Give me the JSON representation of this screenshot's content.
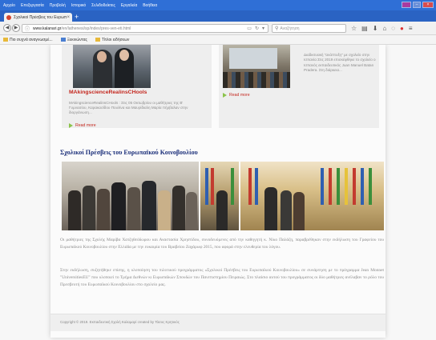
{
  "browser": {
    "menu": [
      "Αρχείο",
      "Επεξεργασία",
      "Προβολή",
      "Ιστορικό",
      "Σελιδοδείκτες",
      "Εργαλεία",
      "Βοήθεια"
    ],
    "tab_title": "Σχολικοί Πρέσβεις του Ευρωπ...",
    "url_domain": "www.kalanari.gr",
    "url_path": "/en/lathenesi/sp/index/pres-ven-eti.html",
    "search_placeholder": "Αναζήτηση",
    "bookmarks": [
      "Πιο συχνά αναγνωσμέ...",
      "Ξεκινώντας",
      "Τίτλοι ειδήσεων"
    ]
  },
  "cards": [
    {
      "title": "MAkingscienceRealinsCHools",
      "body": "MAkingscienceRealinsCHools : Στις 05 Οκτωβρίου οι μαθήτριες της Β' Γυμνασίου, Καρακασίδου Πουλίνα και Μαυρίδιαλη Μαρία πήρβαλαν στην διοργάνωση...",
      "more": "Read more"
    },
    {
      "body": "Διαδικτυακή \"ανάπτυξη\" με σχολείο στην Ισπανία Στις 2019 επισκέφθηκε το σχολείο ο Ισπανός εκπαιδευτικός Juan Manuel Batan Pradera. Στη διάρκεια...",
      "more": "Read more"
    }
  ],
  "section": {
    "title": "Σχολικοί Πρέσβεις του Ευρωπαϊκού Κοινοβουλίου",
    "paragraph1": "Οι μαθήτριες της Σχολής Μαρίβα Χατζηθεόδωρου και Αναστασία Χρηστίδου, συνοδευόμενες από την καθηγητή κ. Νίκο Παλάζη, παραβρέθηκαν στην εκδήλωση του Γραφείου του Ευρωπαϊκού Κοινοβουλίου στην Ελλάδα με την ευκαιρία του Βραβείου Ζαχάρωφ 2015, που αφορά στην ελευθερία του λόγου.",
    "paragraph2": "Στην εκδήλωση, συζητήθηκε επίσης, η υλοποίηση του πιλοτικού προγράμματος «Σχολικοί Πρέσβεις του Ευρωπαϊκού Κοινοβουλίου» σε συνάρτηση με το πρόγραμμα Jean Monnet \"UniversitiesEU\" που υλοποιεί το Τμήμα Διεθνών κι Ευρωπαϊκών Σπουδών του Πανεπιστημίου Πειραιώς. Στο πλαίσιο αυτού του προγράμματος οι δύο μαθήτριες ανέλαβαν το ρόλο του Πρεσβευτή του Ευρωπαϊκού Κοινοβουλίου στο σχολείο μας."
  },
  "footer": {
    "text": "Copyright © 2019. Εκπαιδευτική Σχολή Καλαμαρί created by Τάσος Κρητικός"
  },
  "colors": {
    "link_red": "#c4281f",
    "heading_blue": "#1b2f7a",
    "arrow_green": "#8bc34a"
  }
}
